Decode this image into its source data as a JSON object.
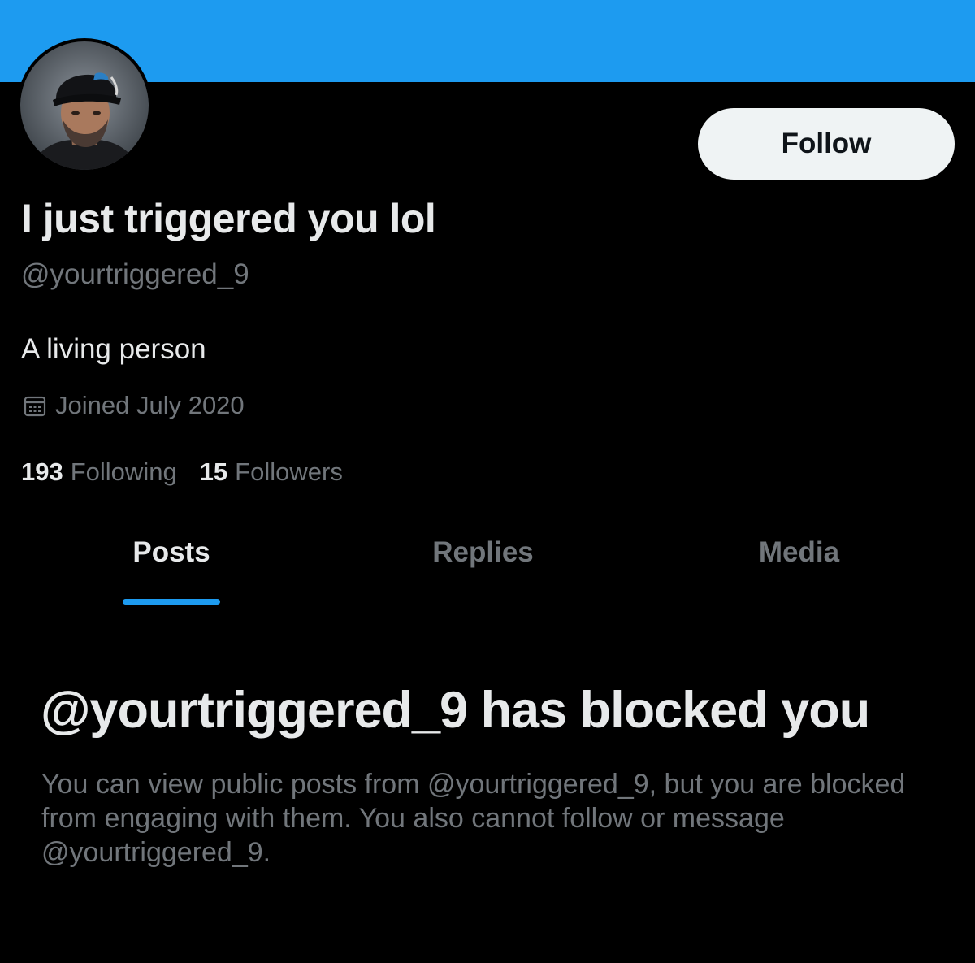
{
  "profile": {
    "display_name": "I just triggered you lol",
    "handle": "@yourtriggered_9",
    "bio": "A living person",
    "joined": "Joined July 2020",
    "following_count": "193",
    "following_label": "Following",
    "followers_count": "15",
    "followers_label": "Followers",
    "avatar_icon": "profile-photo"
  },
  "actions": {
    "follow_label": "Follow"
  },
  "tabs": [
    {
      "label": "Posts",
      "active": true
    },
    {
      "label": "Replies",
      "active": false
    },
    {
      "label": "Media",
      "active": false
    }
  ],
  "blocked": {
    "title": "@yourtriggered_9 has blocked you",
    "message": "You can view public posts from @yourtriggered_9, but you are blocked from engaging with them. You also cannot follow or message @yourtriggered_9."
  },
  "colors": {
    "banner": "#1d9bf0",
    "background": "#000000",
    "accent": "#1d9bf0",
    "primary_text": "#e7e9ea",
    "secondary_text": "#71767b"
  },
  "icons": {
    "calendar": "calendar-icon"
  }
}
